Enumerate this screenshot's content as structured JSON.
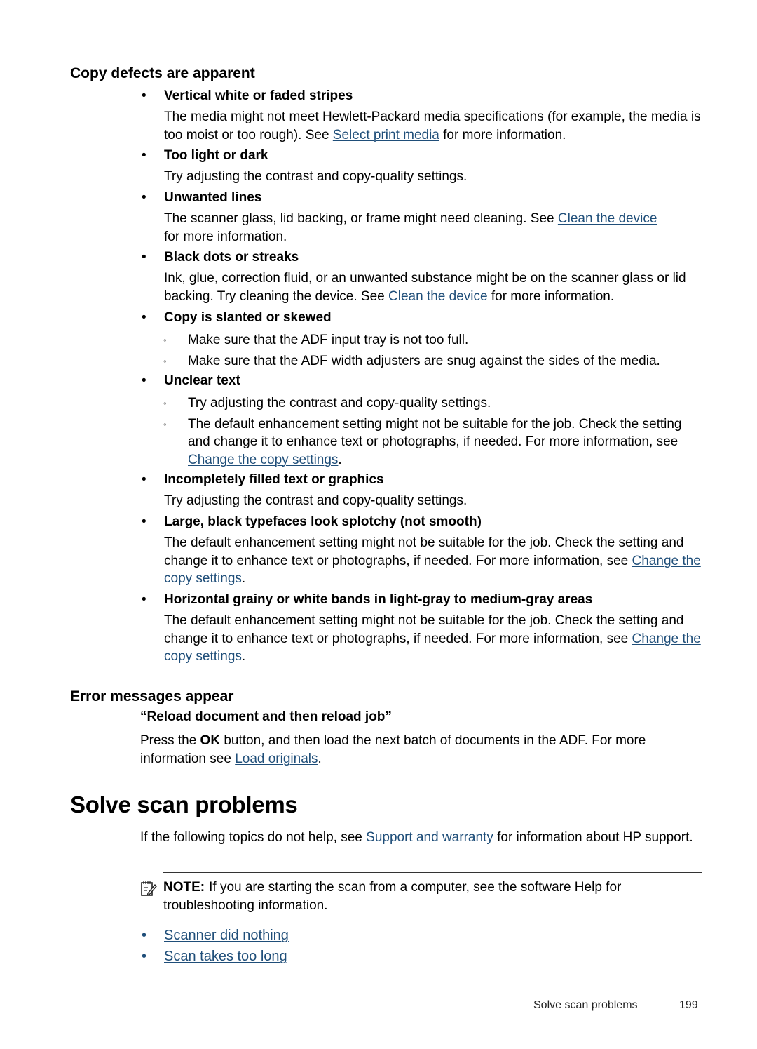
{
  "sections": {
    "copy_defects": {
      "heading": "Copy defects are apparent",
      "items": [
        {
          "title": "Vertical white or faded stripes",
          "body_pre": "The media might not meet Hewlett-Packard media specifications (for example, the media is too moist or too rough). See ",
          "link": "Select print media",
          "body_post": " for more information."
        },
        {
          "title": "Too light or dark",
          "body_pre": "Try adjusting the contrast and copy-quality settings."
        },
        {
          "title": "Unwanted lines",
          "body_pre": "The scanner glass, lid backing, or frame might need cleaning. See ",
          "link": "Clean the device",
          "body_post": " for more information."
        },
        {
          "title": "Black dots or streaks",
          "body_pre": "Ink, glue, correction fluid, or an unwanted substance might be on the scanner glass or lid backing. Try cleaning the device. See ",
          "link": "Clean the device",
          "body_post": " for more information."
        },
        {
          "title": "Copy is slanted or skewed",
          "subitems": [
            {
              "text": "Make sure that the ADF input tray is not too full."
            },
            {
              "text": "Make sure that the ADF width adjusters are snug against the sides of the media."
            }
          ]
        },
        {
          "title": "Unclear text",
          "subitems": [
            {
              "text": "Try adjusting the contrast and copy-quality settings."
            },
            {
              "text": "The default enhancement setting might not be suitable for the job. Check the setting and change it to enhance text or photographs, if needed. For more information, see ",
              "link": "Change the copy settings",
              "post": "."
            }
          ]
        },
        {
          "title": "Incompletely filled text or graphics",
          "body_pre": "Try adjusting the contrast and copy-quality settings."
        },
        {
          "title": "Large, black typefaces look splotchy (not smooth)",
          "body_pre": "The default enhancement setting might not be suitable for the job. Check the setting and change it to enhance text or photographs, if needed. For more information, see ",
          "link": "Change the copy settings",
          "body_post": "."
        },
        {
          "title": "Horizontal grainy or white bands in light-gray to medium-gray areas",
          "body_pre": "The default enhancement setting might not be suitable for the job. Check the setting and change it to enhance text or photographs, if needed. For more information, see ",
          "link": "Change the copy settings",
          "body_post": "."
        }
      ]
    },
    "error_messages": {
      "heading": "Error messages appear",
      "title": "“Reload document and then reload job”",
      "body_pre": "Press the ",
      "body_bold": "OK",
      "body_mid": " button, and then load the next batch of documents in the ADF. For more information see ",
      "link": "Load originals",
      "body_post": "."
    },
    "scan_problems": {
      "heading": "Solve scan problems",
      "intro_pre": "If the following topics do not help, see ",
      "intro_link": "Support and warranty",
      "intro_post": " for information about HP support.",
      "note_icon": "note-pencil-icon",
      "note_label": "NOTE:",
      "note_text": "If you are starting the scan from a computer, see the software Help for troubleshooting information.",
      "topics": [
        "Scanner did nothing",
        "Scan takes too long"
      ]
    }
  },
  "bullet_glyph": "•",
  "sub_bullet_glyph": "◦",
  "link_color": "#1f4e79",
  "footer": {
    "section": "Solve scan problems",
    "page_number": "199"
  }
}
